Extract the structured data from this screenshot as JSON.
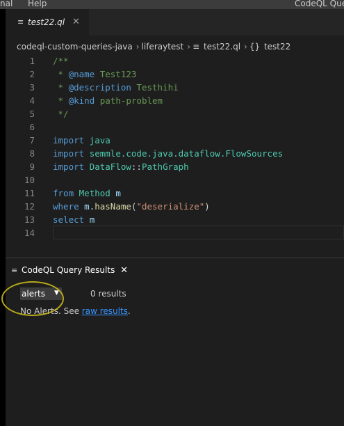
{
  "menubar": {
    "item1": "nal",
    "item2": "Help",
    "window_title": "CodeQL Quer"
  },
  "tab": {
    "label": "test22.ql",
    "close": "✕",
    "icon": "lines-icon"
  },
  "breadcrumb": {
    "parts": [
      "codeql-custom-queries-java",
      "liferaytest",
      "test22.ql",
      "test22"
    ],
    "separator": "›"
  },
  "editor": {
    "line_numbers": [
      "1",
      "2",
      "3",
      "4",
      "5",
      "6",
      "7",
      "8",
      "9",
      "10",
      "11",
      "12",
      "13",
      "14"
    ]
  },
  "panel": {
    "title": "CodeQL Query Results",
    "close": "✕",
    "select_value": "alerts",
    "result_count": "0 results",
    "no_alerts_text": "No Alerts. See",
    "raw_results_link": "raw results",
    "period": "."
  },
  "colors": {
    "comment": "#6a9955",
    "keyword": "#569cd6",
    "type": "#4ec9b0",
    "link": "#3794ff",
    "annotation": "#c8b81a"
  }
}
